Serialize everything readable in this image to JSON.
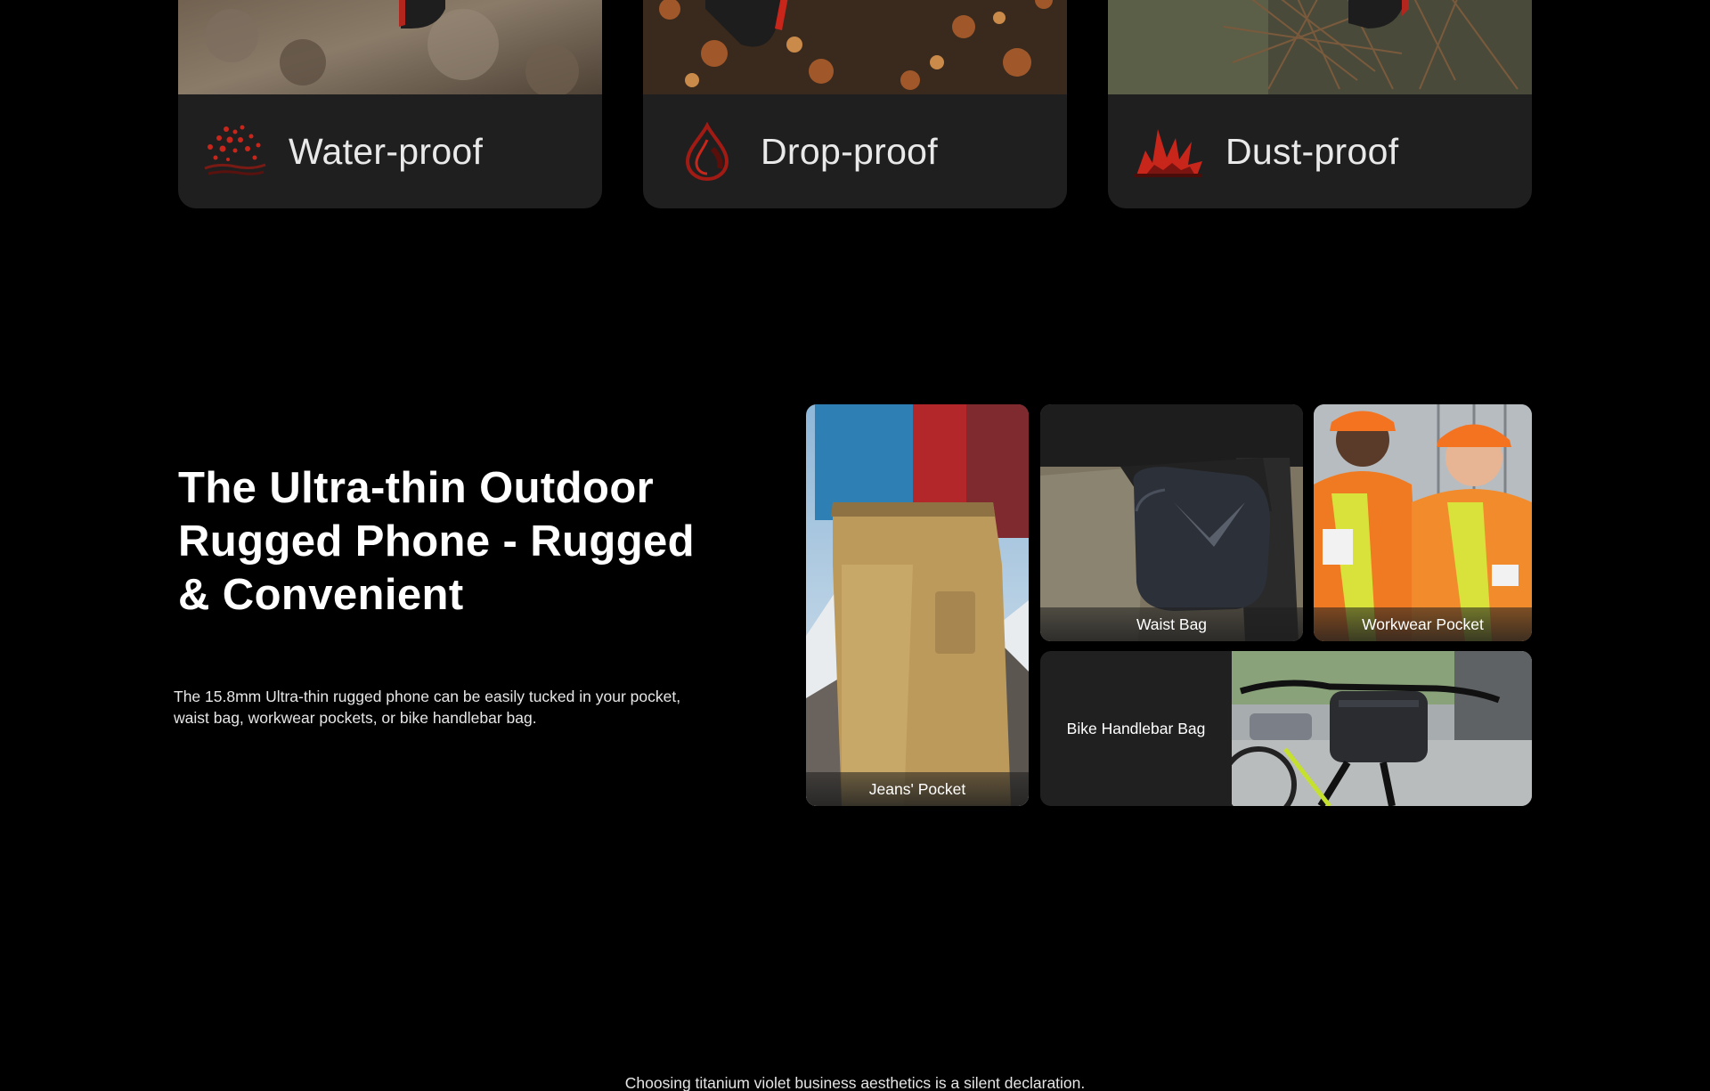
{
  "features": [
    {
      "title": "Water-proof",
      "icon": "water-drops-icon"
    },
    {
      "title": "Drop-proof",
      "icon": "drop-impact-icon"
    },
    {
      "title": "Dust-proof",
      "icon": "dust-burst-icon"
    }
  ],
  "section": {
    "headline_lines": [
      "The Ultra-thin Outdoor",
      "Rugged Phone - Rugged",
      "& Convenient"
    ],
    "description_lines": [
      "The 15.8mm Ultra-thin rugged phone can be easily tucked in your pocket,",
      "waist bag, workwear pockets, or bike handlebar bag."
    ]
  },
  "gallery": {
    "jeans": "Jeans' Pocket",
    "waist": "Waist Bag",
    "workwear": "Workwear Pocket",
    "bike": "Bike Handlebar Bag"
  },
  "footer": {
    "teaser": "Choosing titanium violet business aesthetics is a silent declaration."
  },
  "colors": {
    "background": "#000000",
    "card": "#1f1f20",
    "accent_red": "#c8261b"
  }
}
